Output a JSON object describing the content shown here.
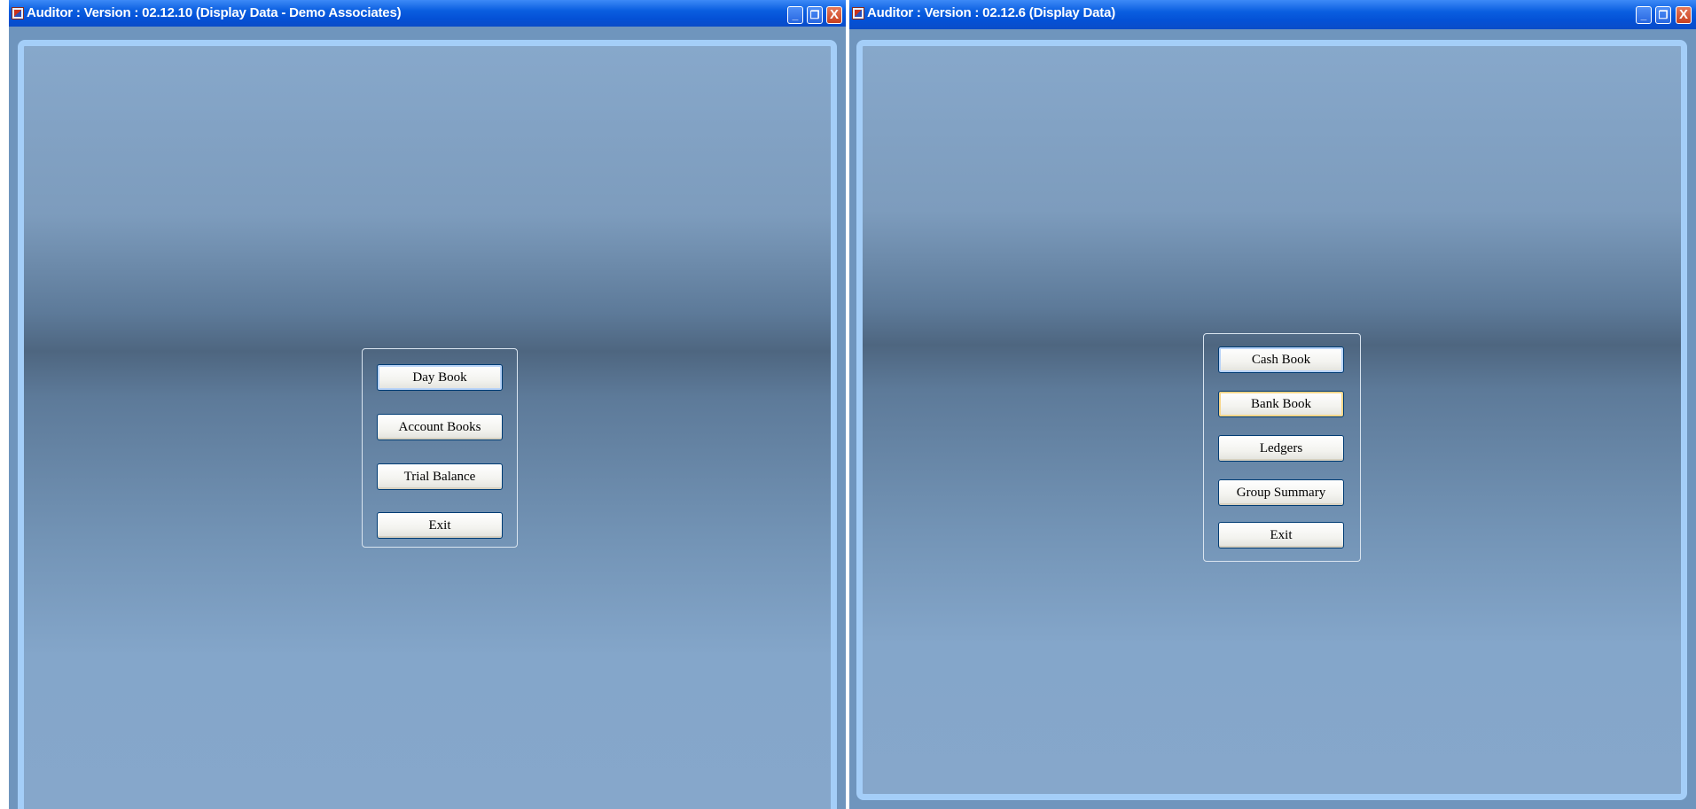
{
  "left_window": {
    "title": "Auditor : Version : 02.12.10 (Display Data - Demo Associates)",
    "buttons": [
      "Day Book",
      "Account Books",
      "Trial Balance",
      "Exit"
    ]
  },
  "right_window": {
    "title": "Auditor : Version : 02.12.6 (Display Data)",
    "buttons": [
      "Cash Book",
      "Bank Book",
      "Ledgers",
      "Group Summary",
      "Exit"
    ]
  },
  "window_controls": {
    "minimize": "_",
    "restore": "❐",
    "close": "X"
  },
  "colors": {
    "titlebar": "#0451d6",
    "frame_border": "#a4cef8",
    "panel": "#6f95bd"
  }
}
